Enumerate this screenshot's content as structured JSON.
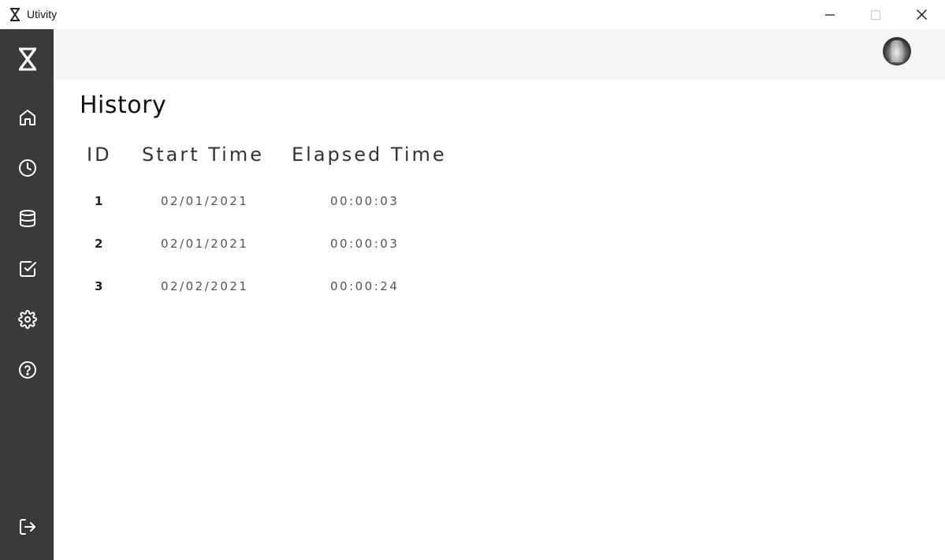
{
  "window": {
    "title": "Utivity"
  },
  "sidebar": {
    "items": [
      {
        "icon": "home-icon"
      },
      {
        "icon": "clock-icon"
      },
      {
        "icon": "database-icon"
      },
      {
        "icon": "checkbox-icon"
      },
      {
        "icon": "gear-icon"
      },
      {
        "icon": "help-icon"
      }
    ],
    "footer_icon": "logout-icon"
  },
  "page": {
    "title": "History"
  },
  "table": {
    "columns": [
      "ID",
      "Start Time",
      "Elapsed Time"
    ],
    "rows": [
      {
        "id": "1",
        "start": "02/01/2021",
        "elapsed": "00:00:03"
      },
      {
        "id": "2",
        "start": "02/01/2021",
        "elapsed": "00:00:03"
      },
      {
        "id": "3",
        "start": "02/02/2021",
        "elapsed": "00:00:24"
      }
    ]
  },
  "colors": {
    "sidebar": "#3a3a3a",
    "header": "#f5f5f8",
    "icon": "#ffffff"
  }
}
